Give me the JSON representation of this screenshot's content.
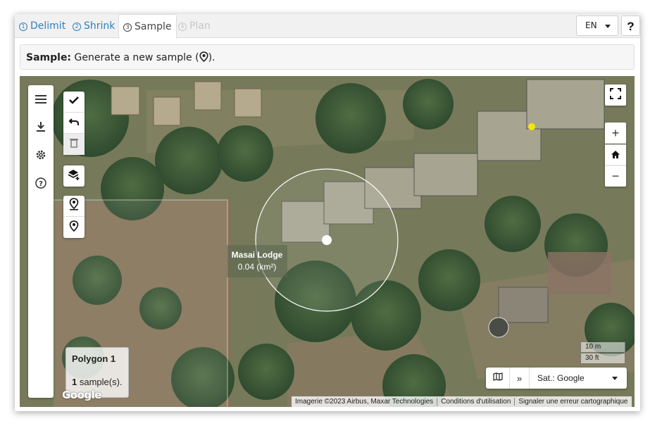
{
  "tabs": [
    {
      "num": "1",
      "label": "Delimit",
      "state": "link"
    },
    {
      "num": "2",
      "label": "Shrink",
      "state": "link"
    },
    {
      "num": "3",
      "label": "Sample",
      "state": "active"
    },
    {
      "num": "4",
      "label": "Plan",
      "state": "disabled"
    }
  ],
  "language": {
    "value": "EN"
  },
  "help": {
    "label": "?"
  },
  "info": {
    "bold": "Sample:",
    "text": " Generate a new sample (",
    "suffix": ")."
  },
  "map": {
    "popup": {
      "title": "Masai Lodge",
      "area": "0.04 (km²)"
    },
    "polygon_card": {
      "title": "Polygon 1",
      "count": "1",
      "count_label": " sample(s)."
    },
    "google_logo": "Google",
    "scale": {
      "metric": "10 m",
      "imperial": "30 ft"
    },
    "layer_select": {
      "value": "Sat.: Google"
    },
    "attribution": [
      "Imagerie ©2023 Airbus, Maxar Technologies",
      "Conditions d'utilisation",
      "Signaler une erreur cartographique"
    ],
    "zoom_in": "+",
    "zoom_out": "−"
  },
  "colors": {
    "accent": "#2f7fbf",
    "sample_point": "#f5e600",
    "buffer_circle": "#ffffff"
  },
  "icons": [
    "menu-icon",
    "download-icon",
    "gear-icon",
    "help-circle-icon",
    "check-icon",
    "undo-icon",
    "trash-icon",
    "layer-add-icon",
    "person-pin-icon",
    "map-pin-icon",
    "fullscreen-icon",
    "home-icon",
    "map-icon",
    "double-chevron-icon"
  ]
}
